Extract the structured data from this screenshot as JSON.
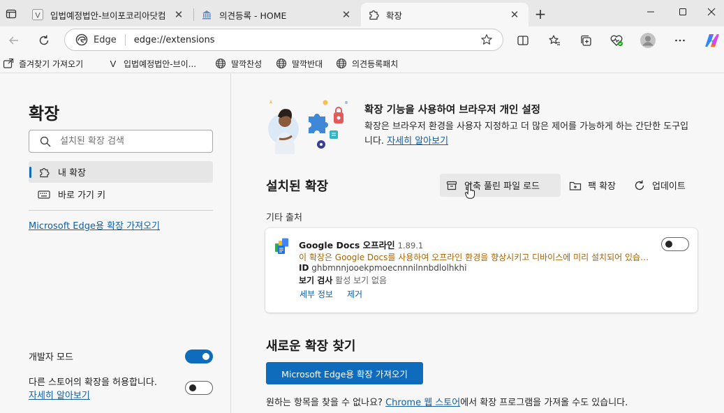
{
  "tabs": [
    {
      "title": "입법예정법안-브이포코리아닷컴",
      "favicon": "v-letter-icon"
    },
    {
      "title": "의견등록 - HOME",
      "favicon": "building-icon"
    },
    {
      "title": "확장",
      "favicon": "puzzle-icon",
      "active": true
    }
  ],
  "address_bar": {
    "site_label": "Edge",
    "url": "edge://extensions"
  },
  "favorites": [
    {
      "label": "즐겨찾기 가져오기",
      "icon": "import-icon"
    },
    {
      "label": "입법예정법안-브이...",
      "icon": "v-letter-icon"
    },
    {
      "label": "딸깍찬성",
      "icon": "globe-icon"
    },
    {
      "label": "딸깍반대",
      "icon": "globe-icon"
    },
    {
      "label": "의견등록패치",
      "icon": "globe-icon"
    }
  ],
  "sidebar": {
    "title": "확장",
    "search_placeholder": "설치된 확장 검색",
    "nav": [
      {
        "label": "내 확장",
        "icon": "puzzle-icon",
        "active": true
      },
      {
        "label": "바로 가기 키",
        "icon": "keyboard-icon"
      }
    ],
    "get_link": "Microsoft Edge용 확장 가져오기",
    "dev_mode_label": "개발자 모드",
    "dev_mode_on": true,
    "other_store_label": "다른 스토어의 확장을 허용합니다.",
    "other_store_on": false,
    "learn_more": "자세히 알아보기"
  },
  "main": {
    "hero_title": "확장 기능을 사용하여 브라우저 개인 설정",
    "hero_desc": "확장은 브라우저 환경을 사용자 지정하고 더 많은 제어를 가능하게 하는 간단한 도구입니다.",
    "hero_link": "자세히 알아보기",
    "installed_title": "설치된 확장",
    "actions": [
      {
        "label": "압축 풀린 파일 로드",
        "icon": "box-icon"
      },
      {
        "label": "팩 확장",
        "icon": "pack-icon"
      },
      {
        "label": "업데이트",
        "icon": "refresh-icon"
      }
    ],
    "source_label": "기타 출처",
    "extension": {
      "name": "Google Docs 오프라인",
      "version": "1.89.1",
      "description": "이 확장은 Google Docs를 사용하여 오프라인 환경을 향상시키고 디바이스에 미리 설치되어 있습니다.",
      "id_label": "ID",
      "id_value": "ghbmnnjooekpmoecnnnilnnbdlolhkhi",
      "inspect_label": "보기 검사",
      "inspect_value": "활성 보기 없음",
      "details_link": "세부 정보",
      "remove_link": "제거",
      "enabled": false
    },
    "find_title": "새로운 확장 찾기",
    "find_button": "Microsoft Edge용 확장 가져오기",
    "find_text_before": "원하는 항목을 찾을 수 없나요? ",
    "find_link": "Chrome 웹 스토어",
    "find_text_after": "에서 확장 프로그램을 가져올 수도 있습니다."
  },
  "colors": {
    "accent": "#0f6cbd",
    "link": "#115ea3",
    "warning_text": "#a76300"
  }
}
